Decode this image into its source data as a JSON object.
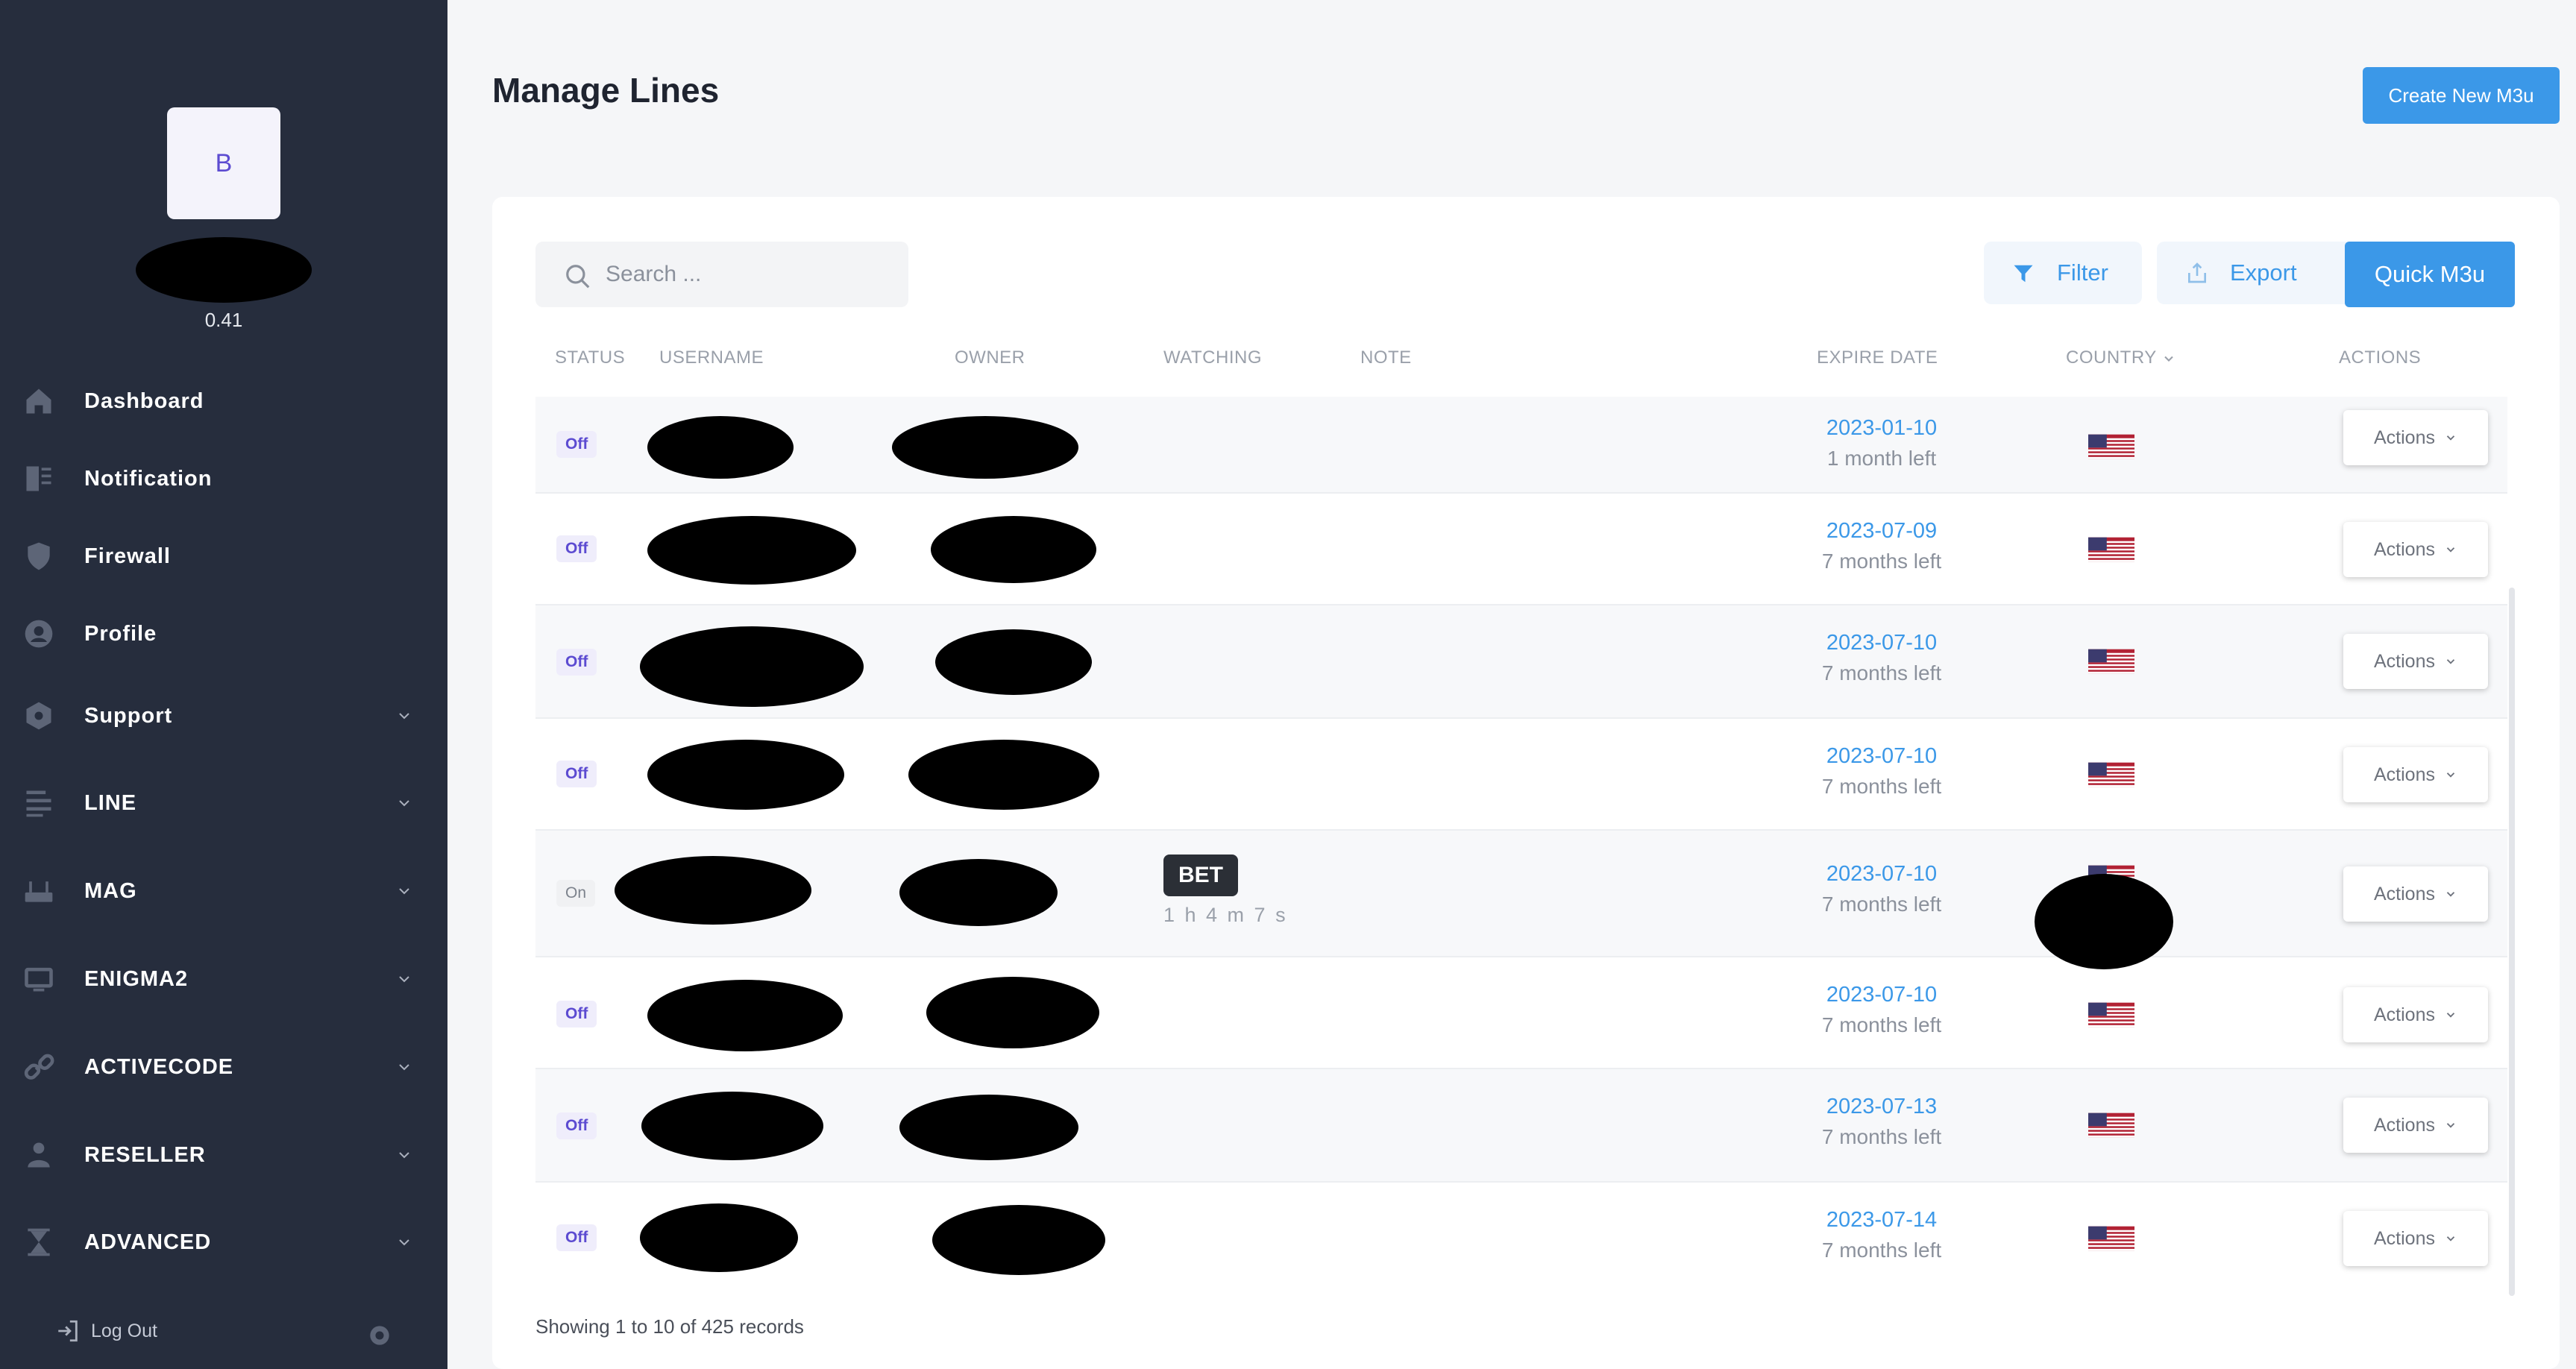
{
  "sidebar": {
    "avatar_letter": "B",
    "balance": "0.41",
    "items": [
      {
        "label": "Dashboard",
        "icon": "home-icon",
        "expandable": false
      },
      {
        "label": "Notification",
        "icon": "notification-icon",
        "expandable": false
      },
      {
        "label": "Firewall",
        "icon": "shield-icon",
        "expandable": false
      },
      {
        "label": "Profile",
        "icon": "user-icon",
        "expandable": false
      },
      {
        "label": "Support",
        "icon": "support-icon",
        "expandable": true
      },
      {
        "label": "LINE",
        "icon": "lines-icon",
        "expandable": true
      },
      {
        "label": "MAG",
        "icon": "router-icon",
        "expandable": true
      },
      {
        "label": "ENIGMA2",
        "icon": "monitor-icon",
        "expandable": true
      },
      {
        "label": "ACTIVECODE",
        "icon": "link-icon",
        "expandable": true
      },
      {
        "label": "RESELLER",
        "icon": "person-icon",
        "expandable": true
      },
      {
        "label": "ADVANCED",
        "icon": "hourglass-icon",
        "expandable": true
      }
    ],
    "logout_label": "Log Out"
  },
  "header": {
    "title": "Manage Lines",
    "create_button": "Create New M3u"
  },
  "toolbar": {
    "search_placeholder": "Search ...",
    "filter_label": "Filter",
    "export_label": "Export",
    "quick_label": "Quick M3u"
  },
  "table": {
    "columns": {
      "status": "STATUS",
      "username": "USERNAME",
      "owner": "OWNER",
      "watching": "WATCHING",
      "note": "NOTE",
      "expire_date": "EXPIRE DATE",
      "country": "COUNTRY",
      "actions": "ACTIONS"
    },
    "rows": [
      {
        "status": "Off",
        "date": "2023-01-10",
        "left": "1 month left",
        "country": "US",
        "actions": "Actions"
      },
      {
        "status": "Off",
        "date": "2023-07-09",
        "left": "7 months left",
        "country": "US",
        "actions": "Actions"
      },
      {
        "status": "Off",
        "date": "2023-07-10",
        "left": "7 months left",
        "country": "US",
        "actions": "Actions"
      },
      {
        "status": "Off",
        "date": "2023-07-10",
        "left": "7 months left",
        "country": "US",
        "actions": "Actions"
      },
      {
        "status": "On",
        "date": "2023-07-10",
        "left": "7 months left",
        "country": "US",
        "actions": "Actions",
        "watching_logo": "BET",
        "watching_time": "1 h 4 m 7 s"
      },
      {
        "status": "Off",
        "date": "2023-07-10",
        "left": "7 months left",
        "country": "US",
        "actions": "Actions"
      },
      {
        "status": "Off",
        "date": "2023-07-13",
        "left": "7 months left",
        "country": "US",
        "actions": "Actions"
      },
      {
        "status": "Off",
        "date": "2023-07-14",
        "left": "7 months left",
        "country": "US",
        "actions": "Actions"
      }
    ],
    "footer": "Showing 1 to 10 of 425 records"
  },
  "colors": {
    "sidebar_bg": "#262d3d",
    "accent": "#3b98e8",
    "badge_off": "#5c4bd1"
  }
}
